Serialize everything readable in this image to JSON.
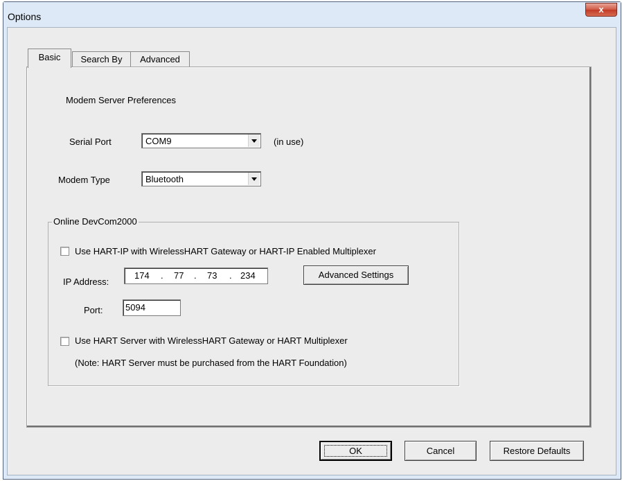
{
  "window": {
    "title": "Options",
    "close_glyph": "x"
  },
  "tabs": [
    {
      "label": "Basic",
      "active": true
    },
    {
      "label": "Search By",
      "active": false
    },
    {
      "label": "Advanced",
      "active": false
    }
  ],
  "basic": {
    "section_title": "Modem Server Preferences",
    "serial_port": {
      "label": "Serial Port",
      "value": "COM9",
      "status": "(in use)"
    },
    "modem_type": {
      "label": "Modem Type",
      "value": "Bluetooth"
    },
    "online_group": {
      "title": "Online DevCom2000",
      "hart_ip_checkbox": {
        "label": "Use HART-IP with WirelessHART Gateway or HART-IP Enabled Multiplexer",
        "checked": false
      },
      "ip_address": {
        "label": "IP Address:",
        "octets": [
          "174",
          "77",
          "73",
          "234"
        ],
        "separator": "."
      },
      "advanced_settings_label": "Advanced Settings",
      "port": {
        "label": "Port:",
        "value": "5094"
      },
      "hart_server_checkbox": {
        "label": "Use HART Server with WirelessHART Gateway or HART Multiplexer",
        "checked": false
      },
      "note": "(Note: HART Server must be purchased from the HART Foundation)"
    }
  },
  "footer": {
    "ok_label": "OK",
    "cancel_label": "Cancel",
    "restore_label": "Restore Defaults"
  }
}
